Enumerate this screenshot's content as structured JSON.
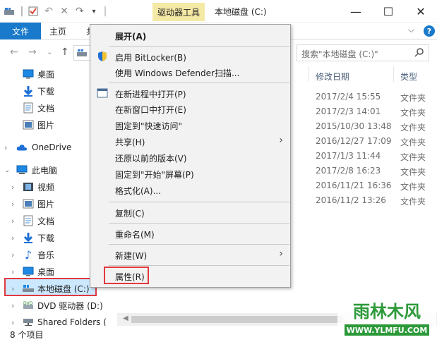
{
  "titlebar": {
    "contextual_tab": "驱动器工具",
    "window_title": "本地磁盘 (C:)",
    "minimize_glyph": "—",
    "maximize_glyph": "☐",
    "close_glyph": "✕"
  },
  "ribbon": {
    "tabs": [
      {
        "label": "文件"
      },
      {
        "label": "主页"
      },
      {
        "label": "共"
      }
    ],
    "help_glyph": "?",
    "expand_glyph": "⌵"
  },
  "address": {
    "search_placeholder": "搜索\"本地磁盘 (C:)\""
  },
  "nav": {
    "items": [
      {
        "label": "桌面",
        "icon": "desktop-icon"
      },
      {
        "label": "下载",
        "icon": "download-icon"
      },
      {
        "label": "文档",
        "icon": "document-icon"
      },
      {
        "label": "图片",
        "icon": "pictures-icon"
      },
      {
        "label": "OneDrive",
        "icon": "onedrive-icon"
      },
      {
        "label": "此电脑",
        "icon": "pc-icon"
      },
      {
        "label": "视频",
        "icon": "videos-icon"
      },
      {
        "label": "图片",
        "icon": "pictures-icon"
      },
      {
        "label": "文档",
        "icon": "document-icon"
      },
      {
        "label": "下载",
        "icon": "download-icon"
      },
      {
        "label": "音乐",
        "icon": "music-icon"
      },
      {
        "label": "桌面",
        "icon": "desktop-icon"
      },
      {
        "label": "本地磁盘 (C:)",
        "icon": "local-disk-icon"
      },
      {
        "label": "DVD 驱动器 (D:)",
        "icon": "dvd-drive-icon"
      },
      {
        "label": "Shared Folders (",
        "icon": "network-drive-icon"
      }
    ]
  },
  "content": {
    "columns": {
      "date": "修改日期",
      "type": "类型"
    },
    "rows": [
      {
        "date": "2017/2/4 15:55",
        "type": "文件夹"
      },
      {
        "date": "2017/2/3 14:01",
        "type": "文件夹"
      },
      {
        "date": "2015/10/30 13:48",
        "type": "文件夹"
      },
      {
        "date": "2016/12/27 17:09",
        "type": "文件夹"
      },
      {
        "date": "2017/1/3 11:44",
        "type": "文件夹"
      },
      {
        "date": "2017/2/8 16:23",
        "type": "文件夹"
      },
      {
        "date": "2016/11/21 16:36",
        "type": "文件夹"
      },
      {
        "date": "2016/11/2 13:26",
        "type": "文件夹"
      }
    ]
  },
  "status": {
    "item_count": "8 个项目"
  },
  "context_menu": {
    "items": [
      {
        "label": "展开(A)"
      },
      {
        "label": "启用 BitLocker(B)"
      },
      {
        "label": "使用 Windows Defender扫描..."
      },
      {
        "label": "在新进程中打开(P)"
      },
      {
        "label": "在新窗口中打开(E)"
      },
      {
        "label": "固定到\"快速访问\""
      },
      {
        "label": "共享(H)"
      },
      {
        "label": "还原以前的版本(V)"
      },
      {
        "label": "固定到\"开始\"屏幕(P)"
      },
      {
        "label": "格式化(A)..."
      },
      {
        "label": "复制(C)"
      },
      {
        "label": "重命名(M)"
      },
      {
        "label": "新建(W)"
      },
      {
        "label": "属性(R)"
      }
    ]
  },
  "watermark": {
    "name": "雨林木风",
    "url": "WWW.YLMFU.COM"
  },
  "colors": {
    "accent": "#1979ca",
    "contextual_tab": "#f5e9a6",
    "highlight_red": "#e0393e",
    "selection": "#cce8ff",
    "menu_bg": "#f2f2f2"
  }
}
